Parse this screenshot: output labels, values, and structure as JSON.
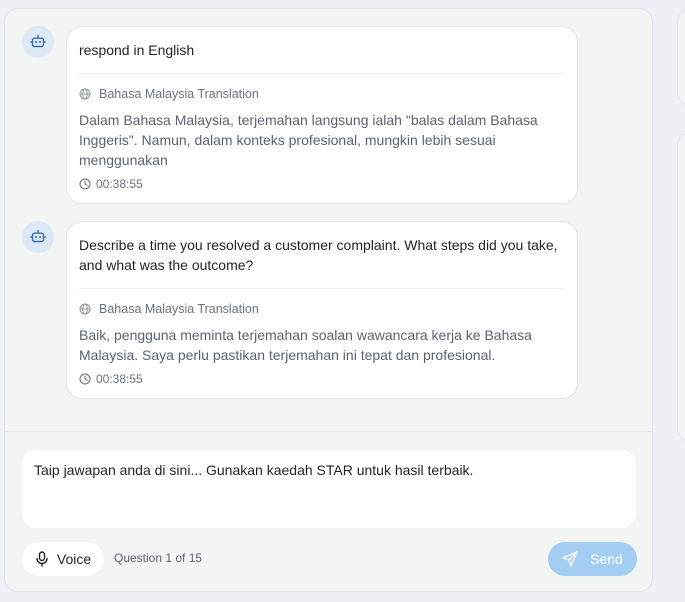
{
  "messages": [
    {
      "text": "respond in English",
      "translation_label": "Bahasa Malaysia Translation",
      "translation_text": "Dalam Bahasa Malaysia, terjemahan langsung ialah \"balas dalam Bahasa Inggeris\". Namun, dalam konteks profesional, mungkin lebih sesuai menggunakan",
      "time": "00:38:55"
    },
    {
      "text": "Describe a time you resolved a customer complaint. What steps did you take, and what was the outcome?",
      "translation_label": "Bahasa Malaysia Translation",
      "translation_text": "Baik, pengguna meminta terjemahan soalan wawancara kerja ke Bahasa Malaysia. Saya perlu pastikan terjemahan ini tepat dan profesional.",
      "time": "00:38:55"
    }
  ],
  "composer": {
    "placeholder": "Taip jawapan anda di sini... Gunakan kaedah STAR untuk hasil terbaik.",
    "voice_label": "Voice",
    "question_counter": "Question 1 of 15",
    "send_label": "Send"
  },
  "icons": {
    "avatar": "bot-icon",
    "translation": "globe-icon",
    "time": "clock-icon",
    "voice": "microphone-icon",
    "send": "paper-plane-icon"
  },
  "colors": {
    "accent": "#3b82d6",
    "send_disabled": "#a3cdf3",
    "avatar_bg": "#dde9f6"
  }
}
